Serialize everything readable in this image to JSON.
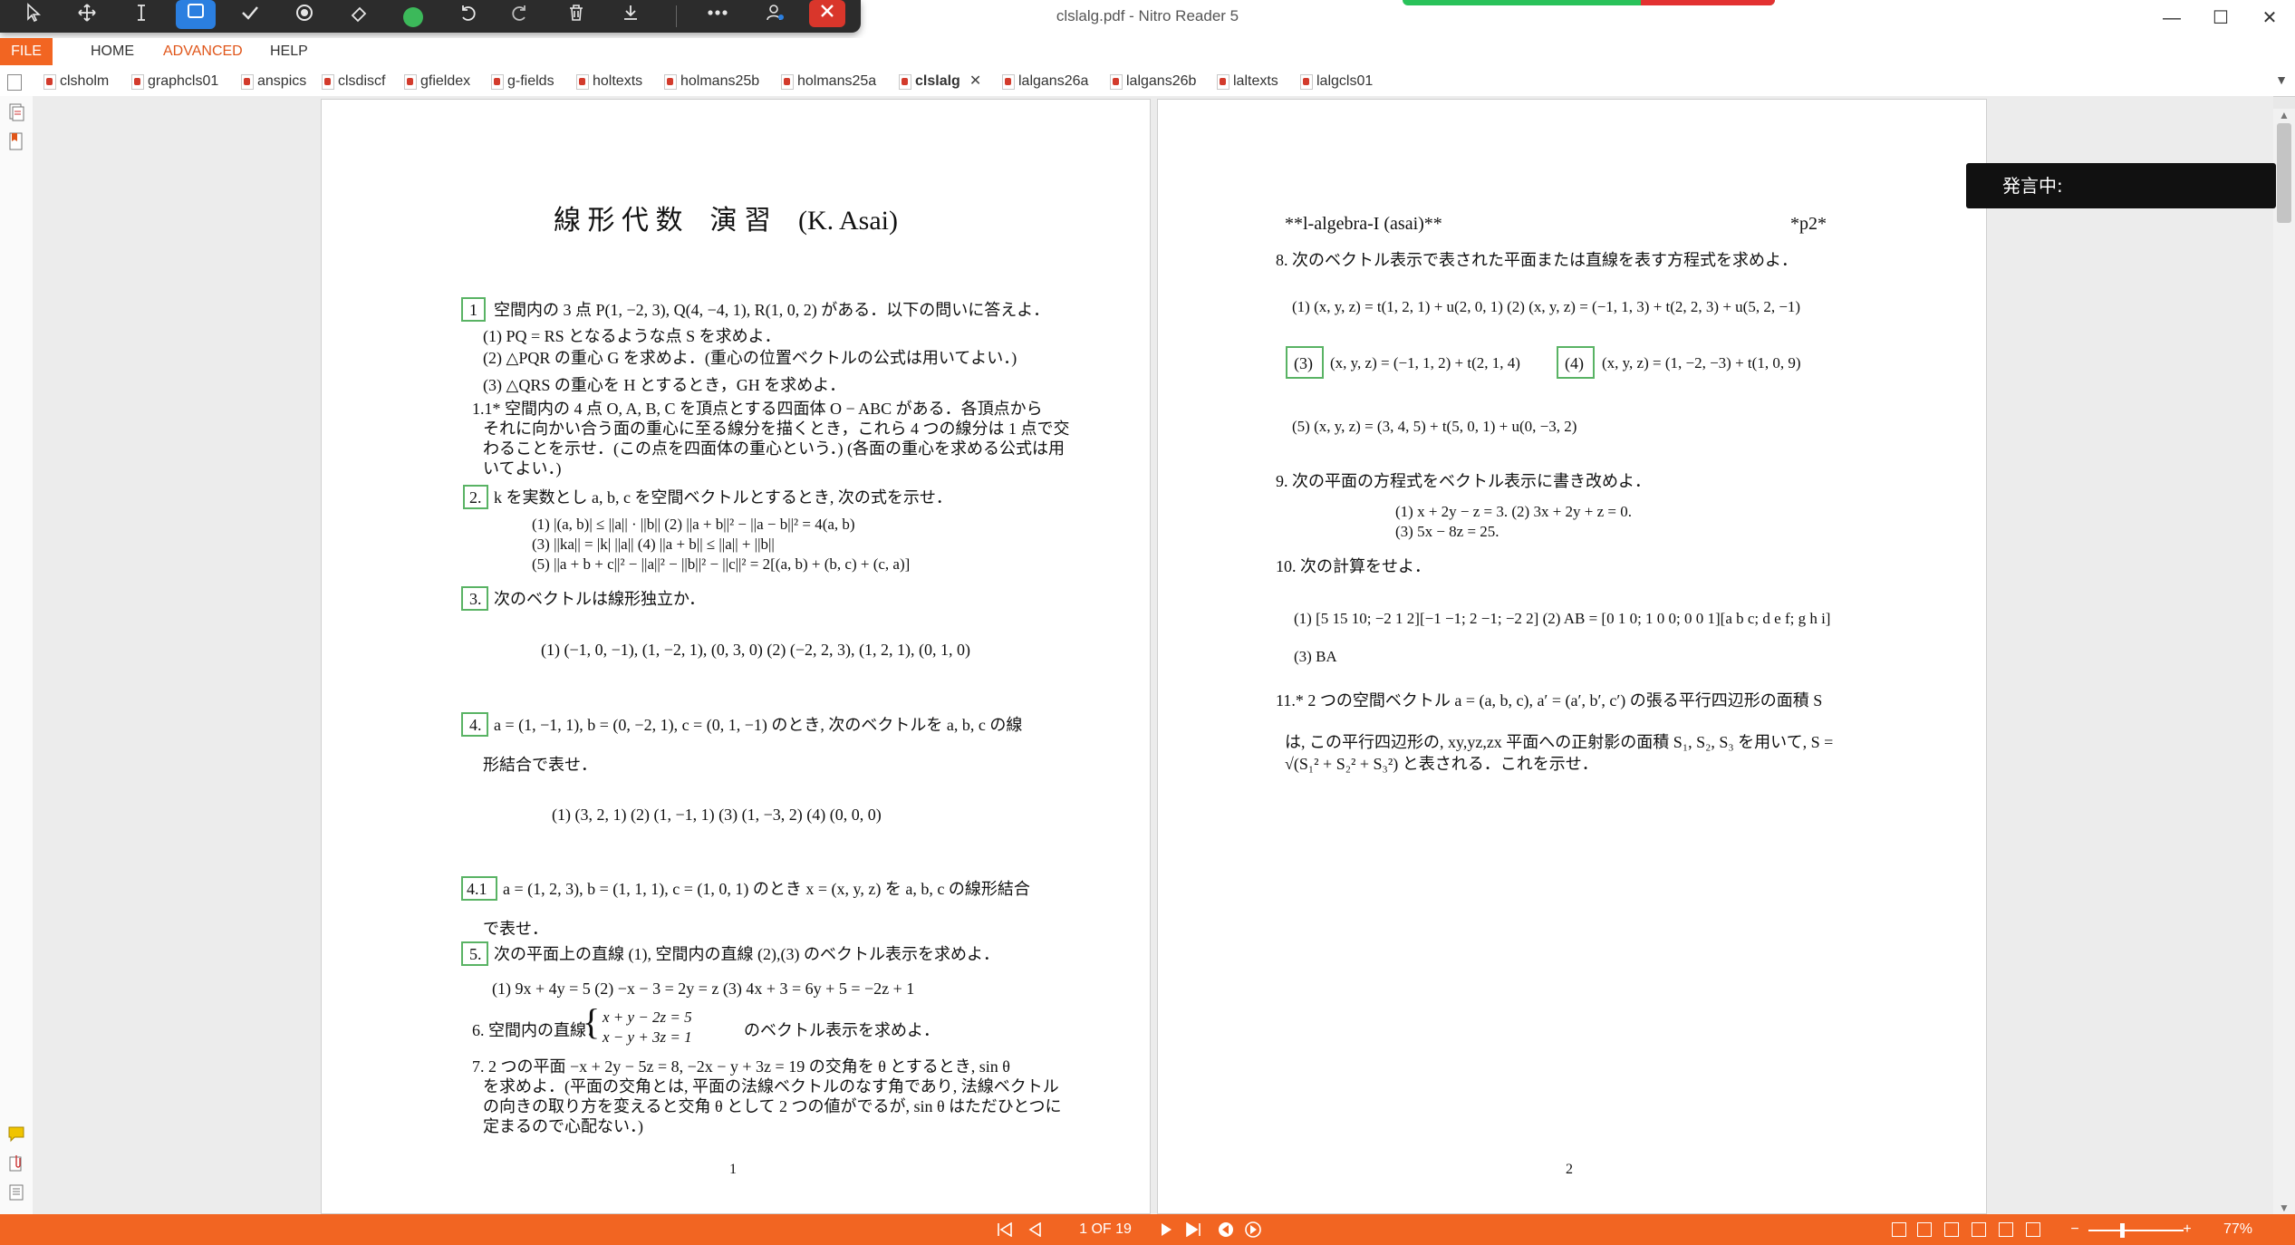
{
  "window": {
    "title": "clslalg.pdf - Nitro Reader 5",
    "minimize": "—",
    "maximize": "☐",
    "close": "✕"
  },
  "floating_toolbar": {
    "tools": [
      "select-arrow-icon",
      "pan-icon",
      "text-cursor-icon",
      "rectangle-select-icon",
      "checkmark-icon",
      "stamp-icon",
      "eraser-icon",
      "color-dot-icon",
      "undo-icon",
      "redo-icon",
      "delete-icon",
      "download-icon",
      "more-icon",
      "share-user-icon",
      "close-icon"
    ]
  },
  "menu": {
    "file": "FILE",
    "home": "HOME",
    "advanced": "ADVANCED",
    "help": "HELP"
  },
  "tabs": [
    {
      "label": "clsholm"
    },
    {
      "label": "graphcls01"
    },
    {
      "label": "anspics"
    },
    {
      "label": "clsdiscf"
    },
    {
      "label": "gfieldex"
    },
    {
      "label": "g-fields"
    },
    {
      "label": "holtexts"
    },
    {
      "label": "holmans25b"
    },
    {
      "label": "holmans25a"
    },
    {
      "label": "clslalg",
      "active": true,
      "close": "✕"
    },
    {
      "label": "lalgans26a"
    },
    {
      "label": "lalgans26b"
    },
    {
      "label": "laltexts"
    },
    {
      "label": "lalgcls01"
    }
  ],
  "page1": {
    "title": "線 形 代 数　演 習　(K. Asai)",
    "p1_num": "1",
    "p1_line": "空間内の 3 点 P(1, −2, 3), Q(4, −4, 1), R(1, 0, 2) がある．以下の問いに答えよ．",
    "p1_1": "(1) PQ = RS となるような点 S を求めよ．",
    "p1_2": "(2) △PQR の重心 G を求めよ．(重心の位置ベクトルの公式は用いてよい．)",
    "p1_3": "(3) △QRS の重心を H とするとき，GH を求めよ．",
    "p11_a": "1.1* 空間内の 4 点 O, A, B, C を頂点とする四面体 O − ABC がある．各頂点から",
    "p11_b": "それに向かい合う面の重心に至る線分を描くとき，これら 4 つの線分は 1 点で交",
    "p11_c": "わることを示せ．(この点を四面体の重心という．) (各面の重心を求める公式は用",
    "p11_d": "いてよい．)",
    "p2_num": "2.",
    "p2_line": "k を実数とし a, b, c を空間ベクトルとするとき, 次の式を示せ．",
    "p2_1": "(1) |(a, b)| ≤ ||a|| · ||b||        (2) ||a + b||² − ||a − b||² = 4(a, b)",
    "p2_2": "(3) ||ka|| = |k| ||a||              (4) ||a + b|| ≤ ||a|| + ||b||",
    "p2_3": "(5) ||a + b + c||² − ||a||² − ||b||² − ||c||² = 2[(a, b) + (b, c) + (c, a)]",
    "p3_num": "3.",
    "p3_line": "次のベクトルは線形独立か．",
    "p3_1": "(1)  (−1, 0, −1), (1, −2, 1), (0, 3, 0)        (2)  (−2, 2, 3), (1, 2, 1), (0, 1, 0)",
    "p4_num": "4.",
    "p4_line": "a = (1, −1, 1), b = (0, −2, 1), c = (0, 1, −1) のとき, 次のベクトルを a, b, c の線",
    "p4_line2": "形結合で表せ．",
    "p4_1": "(1) (3, 2, 1)      (2) (1, −1, 1)      (3) (1, −3, 2)      (4) (0, 0, 0)",
    "p41_num": "4.1",
    "p41_line": "a = (1, 2, 3), b = (1, 1, 1), c = (1, 0, 1) のとき x = (x, y, z) を a, b, c の線形結合",
    "p41_line2": "で表せ．",
    "p5_num": "5.",
    "p5_line": "次の平面上の直線 (1), 空間内の直線 (2),(3) のベクトル表示を求めよ．",
    "p5_1": "(1) 9x + 4y = 5      (2) −x − 3 = 2y = z      (3) 4x + 3 = 6y + 5 = −2z + 1",
    "p6_a": "6. 空間内の直線：",
    "p6_sys1": "x + y − 2z = 5",
    "p6_sys2": "x − y + 3z = 1",
    "p6_b": "のベクトル表示を求めよ．",
    "p7_a": "7. 2 つの平面 −x + 2y − 5z = 8, −2x − y + 3z = 19 の交角を θ とするとき, sin θ",
    "p7_b": "を求めよ．(平面の交角とは, 平面の法線ベクトルのなす角であり, 法線ベクトル",
    "p7_c": "の向きの取り方を変えると交角 θ として 2 つの値がでるが, sin θ はただひとつに",
    "p7_d": "定まるので心配ない．)",
    "footer": "1"
  },
  "page2": {
    "header_left": "**l-algebra-I (asai)**",
    "header_right": "*p2*",
    "p8_line": "8. 次のベクトル表示で表された平面または直線を表す方程式を求めよ．",
    "p8_1": "(1) (x, y, z) = t(1, 2, 1) + u(2, 0, 1)    (2) (x, y, z) = (−1, 1, 3) + t(2, 2, 3) + u(5, 2, −1)",
    "p8_3": "(3)",
    "p8_3eq": "(x, y, z) = (−1, 1, 2) + t(2, 1, 4)",
    "p8_4": "(4)",
    "p8_4eq": "(x, y, z) = (1, −2, −3) + t(1, 0, 9)",
    "p8_5": "(5) (x, y, z) = (3, 4, 5) + t(5, 0, 1) + u(0, −3, 2)",
    "p9_line": "9. 次の平面の方程式をベクトル表示に書き改めよ．",
    "p9_1": "(1) x + 2y − z = 3.            (2) 3x + 2y + z = 0.",
    "p9_2": "(3) 5x − 8z = 25.",
    "p10_line": "10. 次の計算をせよ．",
    "p10_1": "(1) [5 15 10; −2 1 2][−1 −1; 2 −1; −2 2]    (2) AB = [0 1 0; 1 0 0; 0 0 1][a b c; d e f; g h i]",
    "p10_2": "(3) BA",
    "p11_a": "11.* 2 つの空間ベクトル a = (a, b, c), a′ = (a′, b′, c′) の張る平行四辺形の面積 S",
    "p11_b": "は, この平行四辺形の, xy,yz,zx 平面への正射影の面積 S₁, S₂, S₃ を用いて, S =",
    "p11_c": "√(S₁² + S₂² + S₃²) と表される．これを示せ．",
    "footer": "2"
  },
  "overlay": {
    "speaking": "発言中:"
  },
  "status": {
    "page_indicator": "1 OF 19",
    "zoom": "77%",
    "zoom_minus": "−",
    "zoom_plus": "+"
  }
}
